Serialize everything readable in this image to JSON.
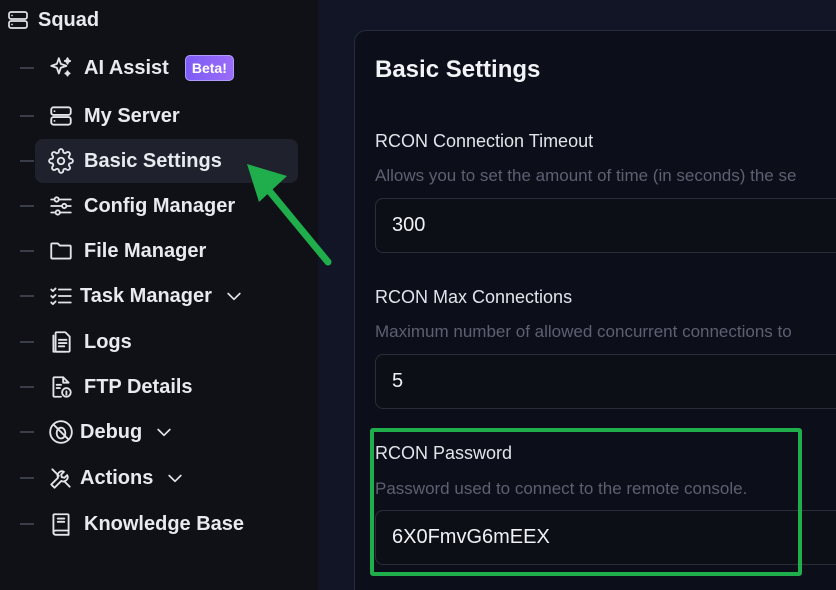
{
  "sidebar": {
    "server_name": "Squad",
    "items": [
      {
        "label": "AI Assist",
        "icon": "sparkles-icon",
        "badge": "Beta!"
      },
      {
        "label": "My Server",
        "icon": "server-icon"
      },
      {
        "label": "Basic Settings",
        "icon": "gear-icon",
        "active": true
      },
      {
        "label": "Config Manager",
        "icon": "sliders-icon"
      },
      {
        "label": "File Manager",
        "icon": "folder-icon"
      },
      {
        "label": "Task Manager",
        "icon": "task-list-icon",
        "expandable": true
      },
      {
        "label": "Logs",
        "icon": "document-icon"
      },
      {
        "label": "FTP Details",
        "icon": "file-info-icon"
      },
      {
        "label": "Debug",
        "icon": "bug-off-icon",
        "expandable": true
      },
      {
        "label": "Actions",
        "icon": "tools-icon",
        "expandable": true
      },
      {
        "label": "Knowledge Base",
        "icon": "book-icon"
      }
    ]
  },
  "main": {
    "title": "Basic Settings",
    "fields": [
      {
        "label": "RCON Connection Timeout",
        "description": "Allows you to set the amount of time (in seconds) the se",
        "value": "300"
      },
      {
        "label": "RCON Max Connections",
        "description": "Maximum number of allowed concurrent connections to",
        "value": "5"
      },
      {
        "label": "RCON Password",
        "description": "Password used to connect to the remote console.",
        "value": "6X0FmvG6mEEX"
      }
    ]
  },
  "colors": {
    "highlight": "#1fae4b",
    "beta": "#8b5cf6"
  }
}
